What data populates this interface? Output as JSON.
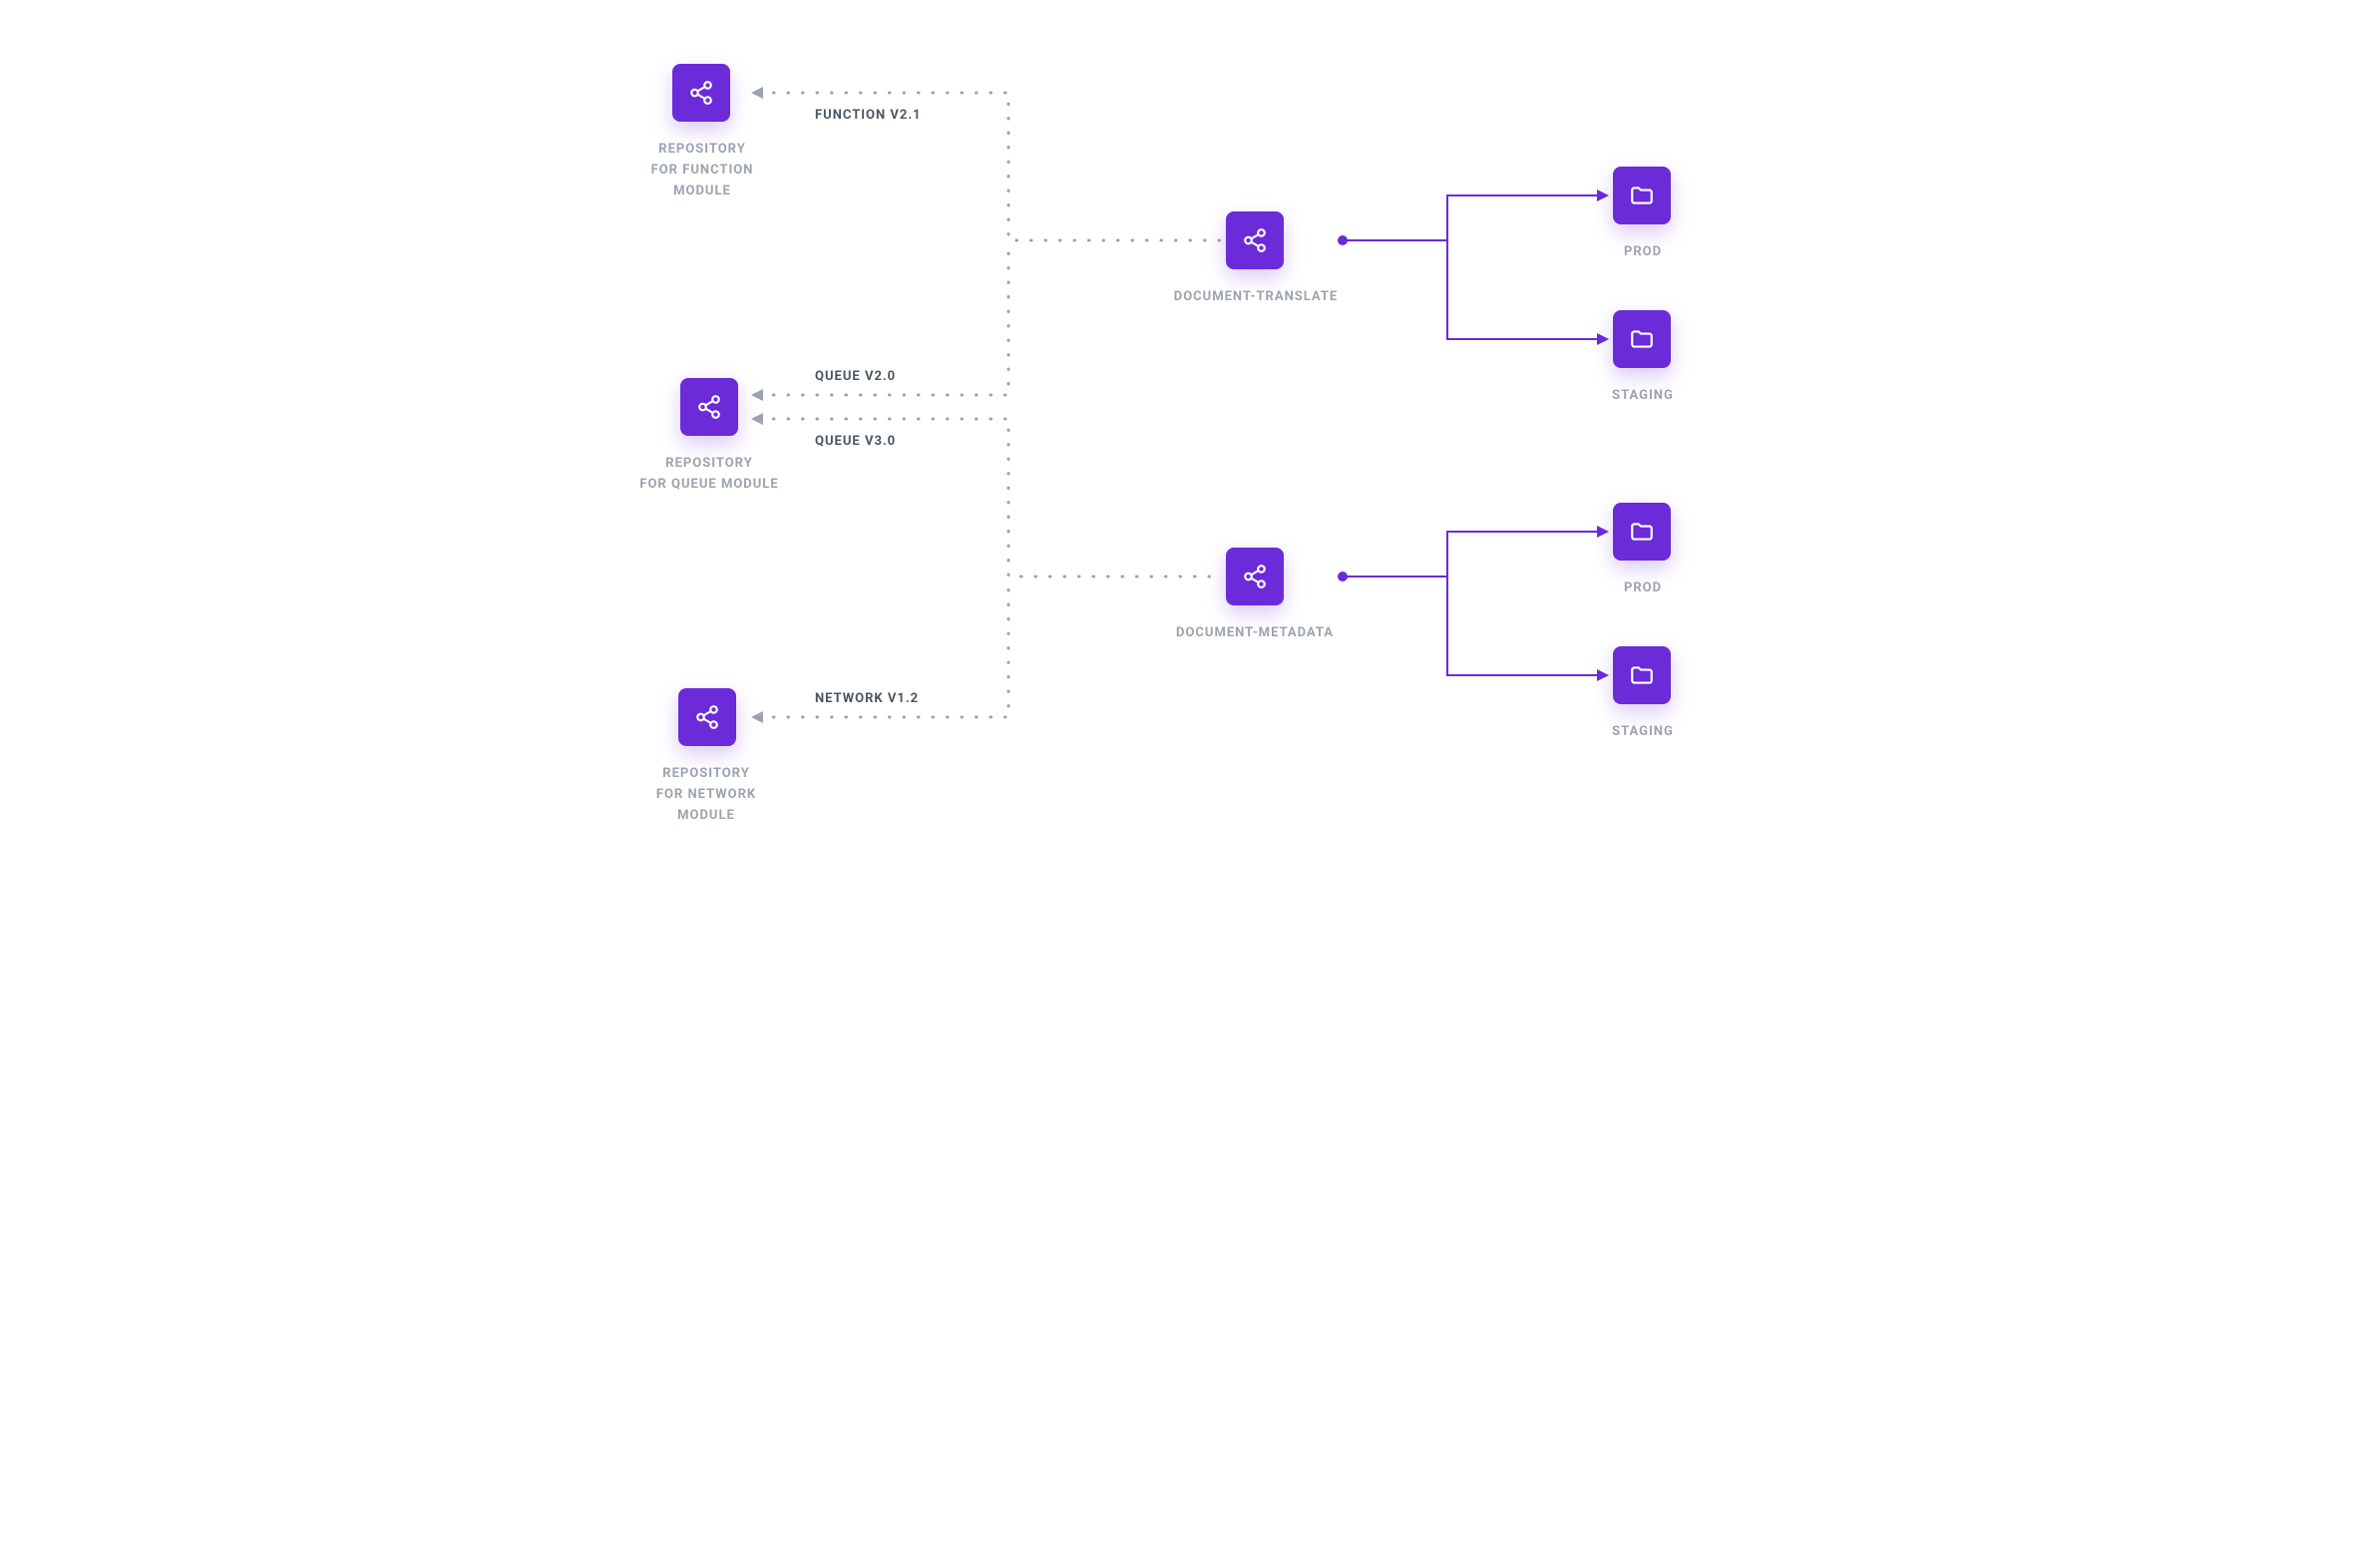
{
  "palette": {
    "node": "#6B2BD9",
    "label": "#9CA3AF",
    "edgeLabel": "#4B5563",
    "dotted": "#9CA3AF",
    "solid": "#6B2BD9"
  },
  "repositories": [
    {
      "id": "funcRepo",
      "label": "REPOSITORY\nFOR FUNCTION\nMODULE"
    },
    {
      "id": "queueRepo",
      "label": "REPOSITORY\nFOR QUEUE MODULE"
    },
    {
      "id": "netRepo",
      "label": "REPOSITORY\nFOR NETWORK\nMODULE"
    }
  ],
  "services": [
    {
      "id": "docTranslate",
      "label": "DOCUMENT-TRANSLATE"
    },
    {
      "id": "docMetadata",
      "label": "DOCUMENT-METADATA"
    }
  ],
  "environments": [
    {
      "id": "prod1",
      "label": "PROD"
    },
    {
      "id": "staging1",
      "label": "STAGING"
    },
    {
      "id": "prod2",
      "label": "PROD"
    },
    {
      "id": "staging2",
      "label": "STAGING"
    }
  ],
  "versionEdges": [
    {
      "id": "funcV21",
      "label": "FUNCTION V2.1"
    },
    {
      "id": "queueV20",
      "label": "QUEUE V2.0"
    },
    {
      "id": "queueV30",
      "label": "QUEUE V3.0"
    },
    {
      "id": "netV12",
      "label": "NETWORK V1.2"
    }
  ]
}
